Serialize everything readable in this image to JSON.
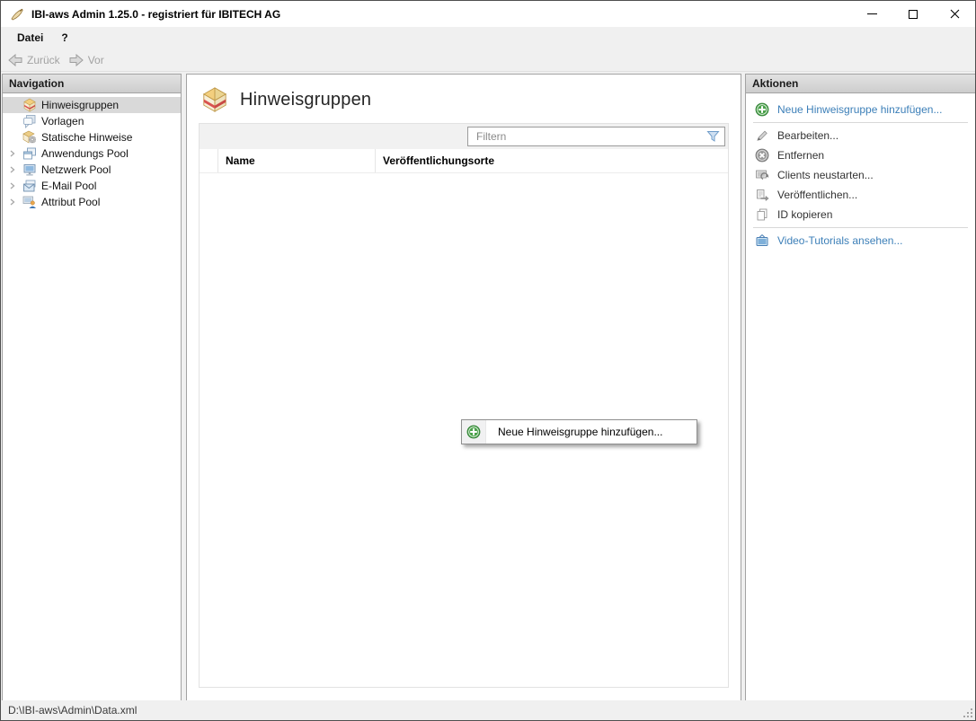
{
  "window": {
    "title": "IBI-aws Admin 1.25.0 - registriert für IBITECH AG"
  },
  "menubar": {
    "items": [
      {
        "label": "Datei"
      },
      {
        "label": "?"
      }
    ]
  },
  "toolbar": {
    "back_label": "Zurück",
    "forward_label": "Vor"
  },
  "navigation": {
    "header": "Navigation",
    "items": [
      {
        "label": "Hinweisgruppen",
        "icon": "notice-groups-box-icon",
        "selected": true,
        "expandable": false
      },
      {
        "label": "Vorlagen",
        "icon": "templates-icon",
        "selected": false,
        "expandable": false
      },
      {
        "label": "Statische Hinweise",
        "icon": "static-notices-icon",
        "selected": false,
        "expandable": false
      },
      {
        "label": "Anwendungs Pool",
        "icon": "applications-icon",
        "selected": false,
        "expandable": true
      },
      {
        "label": "Netzwerk Pool",
        "icon": "network-monitor-icon",
        "selected": false,
        "expandable": true
      },
      {
        "label": "E-Mail Pool",
        "icon": "email-icon",
        "selected": false,
        "expandable": true
      },
      {
        "label": "Attribut Pool",
        "icon": "attribute-user-icon",
        "selected": false,
        "expandable": true
      }
    ]
  },
  "main": {
    "title": "Hinweisgruppen",
    "filter_placeholder": "Filtern",
    "table": {
      "columns": [
        "Name",
        "Veröffentlichungsorte"
      ],
      "rows": []
    },
    "context_menu": {
      "items": [
        {
          "label": "Neue Hinweisgruppe hinzufügen..."
        }
      ]
    }
  },
  "actions": {
    "header": "Aktionen",
    "items": [
      {
        "label": "Neue Hinweisgruppe hinzufügen...",
        "enabled": true,
        "icon": "add-plus-icon"
      },
      {
        "label": "Bearbeiten...",
        "enabled": false,
        "icon": "edit-pencil-icon"
      },
      {
        "label": "Entfernen",
        "enabled": false,
        "icon": "remove-icon"
      },
      {
        "label": "Clients neustarten...",
        "enabled": false,
        "icon": "restart-clients-icon"
      },
      {
        "label": "Veröffentlichen...",
        "enabled": false,
        "icon": "publish-icon"
      },
      {
        "label": "ID kopieren",
        "enabled": false,
        "icon": "copy-id-icon"
      },
      {
        "label": "Video-Tutorials ansehen...",
        "enabled": true,
        "icon": "video-tutorials-icon"
      }
    ]
  },
  "statusbar": {
    "path": "D:\\IBI-aws\\Admin\\Data.xml"
  },
  "colors": {
    "link_blue": "#3c7fb8",
    "selection_gray": "#d9d9d9",
    "accent_green": "#4aa14a",
    "box_gold": "#f3cf7e",
    "box_red": "#d9534f"
  }
}
